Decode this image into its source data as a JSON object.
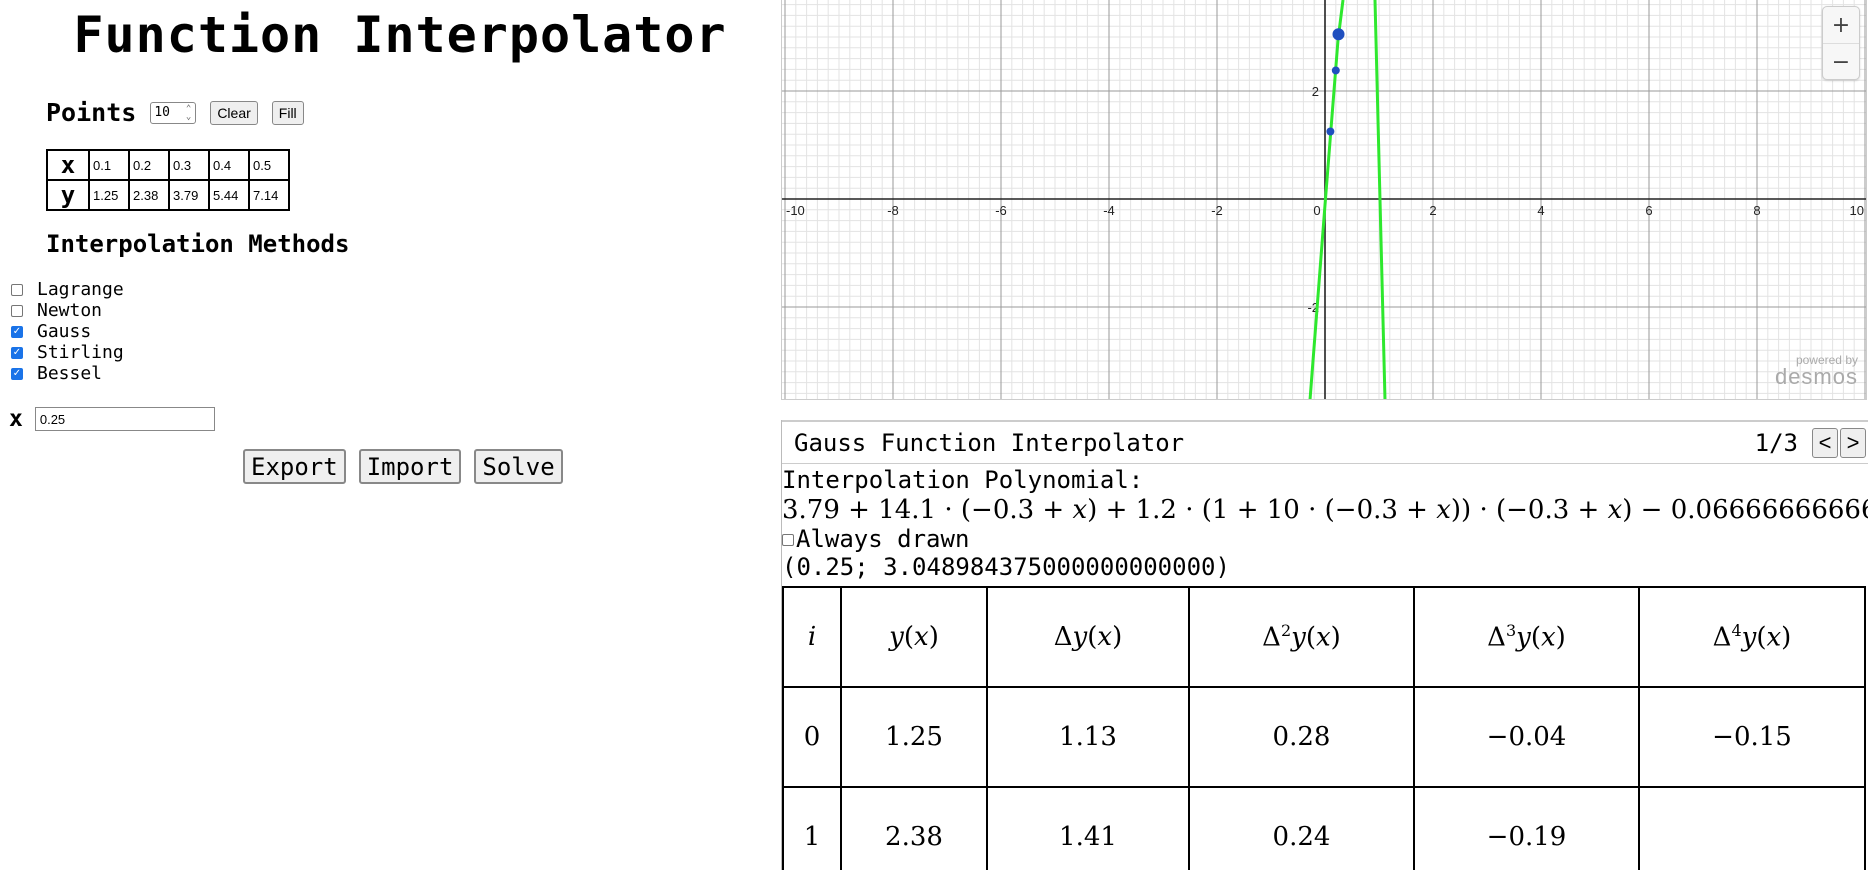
{
  "app": {
    "title": "Function Interpolator"
  },
  "points": {
    "label": "Points",
    "count": "10",
    "clear_label": "Clear",
    "fill_label": "Fill",
    "x_header": "x",
    "y_header": "y",
    "x_values": [
      "0.1",
      "0.2",
      "0.3",
      "0.4",
      "0.5"
    ],
    "y_values": [
      "1.25",
      "2.38",
      "3.79",
      "5.44",
      "7.14"
    ]
  },
  "methods": {
    "title": "Interpolation Methods",
    "items": [
      {
        "label": "Lagrange",
        "checked": false
      },
      {
        "label": "Newton",
        "checked": false
      },
      {
        "label": "Gauss",
        "checked": true
      },
      {
        "label": "Stirling",
        "checked": true
      },
      {
        "label": "Bessel",
        "checked": true
      }
    ]
  },
  "x_input": {
    "label": "x",
    "value": "0.25"
  },
  "actions": {
    "export_label": "Export",
    "import_label": "Import",
    "solve_label": "Solve"
  },
  "graph": {
    "x_ticks": [
      "-10",
      "-8",
      "-6",
      "-4",
      "-2",
      "0",
      "2",
      "4",
      "6",
      "8",
      "10"
    ],
    "y_ticks": [
      "2",
      "-2"
    ],
    "zoom_in": "+",
    "zoom_out": "−",
    "powered_by": "powered by",
    "brand": "desmos",
    "curve_color": "#2ee82e",
    "point_color": "#1f4fbf",
    "points": [
      {
        "x": 0.1,
        "y": 1.25
      },
      {
        "x": 0.2,
        "y": 2.38
      },
      {
        "x": 0.25,
        "y": 3.05
      }
    ]
  },
  "panel": {
    "title": "Gauss Function Interpolator",
    "page": "1/3",
    "prev": "<",
    "next": ">",
    "poly_label": "Interpolation Polynomial:",
    "always_drawn": "Always drawn",
    "result": "(0.25; 3.048984375000000000000)",
    "table": {
      "rows": [
        {
          "i": "0",
          "y": "1.25",
          "d1": "1.13",
          "d2": "0.28",
          "d3": "−0.04",
          "d4": "−0.15"
        },
        {
          "i": "1",
          "y": "2.38",
          "d1": "1.41",
          "d2": "0.24",
          "d3": "−0.19",
          "d4": ""
        }
      ]
    }
  }
}
